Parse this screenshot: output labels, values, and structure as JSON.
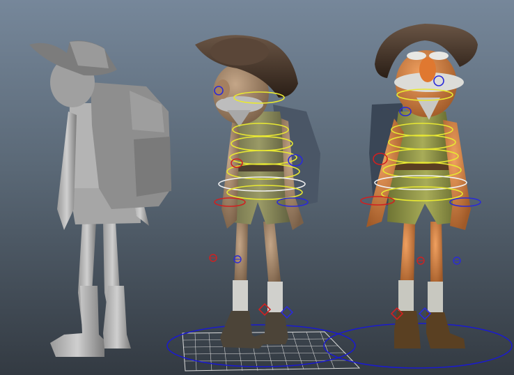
{
  "viewport": {
    "characters": [
      {
        "name": "grey-model",
        "display": "untextured"
      },
      {
        "name": "rigged-model",
        "display": "textured-desaturated"
      },
      {
        "name": "rigged-textured-model",
        "display": "textured-color"
      }
    ]
  },
  "colors": {
    "bg_top": "#76879a",
    "bg_bottom": "#333a42",
    "control_yellow": "#e8e832",
    "control_blue": "#2a2ad8",
    "control_red": "#d02020",
    "control_white": "#f0f0f0",
    "grid_line": "#dcdcdc"
  },
  "icons": [
    "hat",
    "backpack",
    "rig-control",
    "ground-grid",
    "locator"
  ]
}
